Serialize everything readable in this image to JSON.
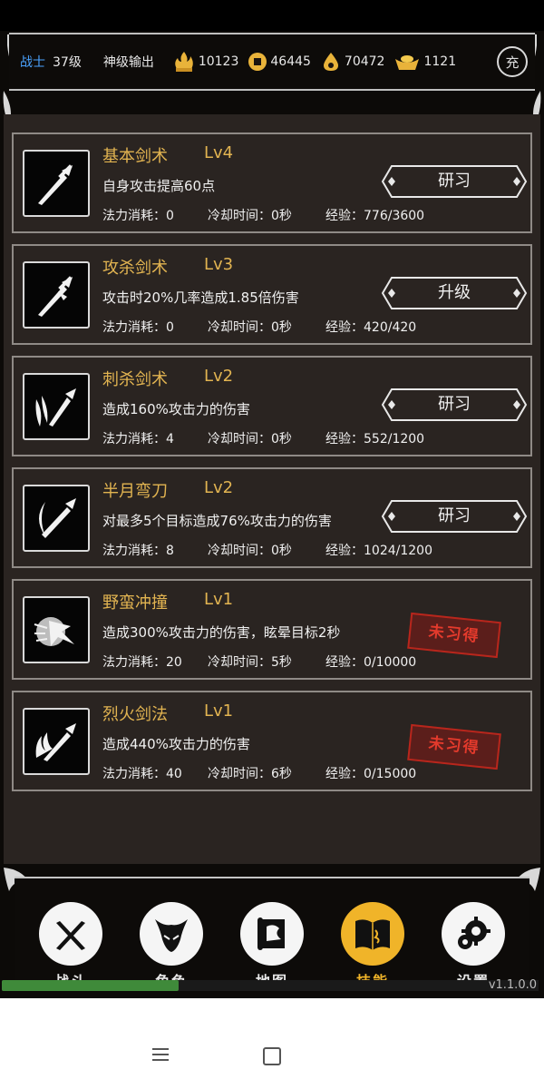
{
  "header": {
    "class_name": "战士",
    "level": "37级",
    "title": "神级输出",
    "resources": [
      {
        "icon": "flame-gold-icon",
        "value": "10123"
      },
      {
        "icon": "coin-icon",
        "value": "46445"
      },
      {
        "icon": "gem-drop-icon",
        "value": "70472"
      },
      {
        "icon": "gold-ingot-icon",
        "value": "1121"
      }
    ],
    "charge_label": "充"
  },
  "skills": [
    {
      "name": "基本剑术",
      "level": "Lv4",
      "description": "自身攻击提高60点",
      "mana": "法力消耗：0",
      "cooldown": "冷却时间：0秒",
      "exp": "经验：776/3600",
      "action": "研习",
      "learned": true,
      "icon": "sword-icon"
    },
    {
      "name": "攻杀剑术",
      "level": "Lv3",
      "description": "攻击时20%几率造成1.85倍伤害",
      "mana": "法力消耗：0",
      "cooldown": "冷却时间：0秒",
      "exp": "经验：420/420",
      "action": "升级",
      "learned": true,
      "icon": "sword-strike-icon"
    },
    {
      "name": "刺杀剑术",
      "level": "Lv2",
      "description": "造成160%攻击力的伤害",
      "mana": "法力消耗：4",
      "cooldown": "冷却时间：0秒",
      "exp": "经验：552/1200",
      "action": "研习",
      "learned": true,
      "icon": "sword-thrust-icon"
    },
    {
      "name": "半月弯刀",
      "level": "Lv2",
      "description": "对最多5个目标造成76%攻击力的伤害",
      "mana": "法力消耗：8",
      "cooldown": "冷却时间：0秒",
      "exp": "经验：1024/1200",
      "action": "研习",
      "learned": true,
      "icon": "crescent-blade-icon"
    },
    {
      "name": "野蛮冲撞",
      "level": "Lv1",
      "description": "造成300%攻击力的伤害，眩晕目标2秒",
      "mana": "法力消耗：20",
      "cooldown": "冷却时间：5秒",
      "exp": "经验：0/10000",
      "action": "未习得",
      "learned": false,
      "icon": "charge-dash-icon"
    },
    {
      "name": "烈火剑法",
      "level": "Lv1",
      "description": "造成440%攻击力的伤害",
      "mana": "法力消耗：40",
      "cooldown": "冷却时间：6秒",
      "exp": "经验：0/15000",
      "action": "未习得",
      "learned": false,
      "icon": "flame-sword-icon"
    }
  ],
  "nav": [
    {
      "label": "战斗",
      "icon": "crossed-swords-icon",
      "active": false
    },
    {
      "label": "角色",
      "icon": "helmet-icon",
      "active": false
    },
    {
      "label": "地图",
      "icon": "map-scroll-icon",
      "active": false
    },
    {
      "label": "技能",
      "icon": "skill-book-icon",
      "active": true
    },
    {
      "label": "设置",
      "icon": "gears-icon",
      "active": false
    }
  ],
  "progress": 0.33,
  "version": "v1.1.0.0",
  "colors": {
    "accent": "#e2b451",
    "active_nav": "#f0b429",
    "class_name": "#4aa3ff",
    "stamp": "#b8261c"
  }
}
